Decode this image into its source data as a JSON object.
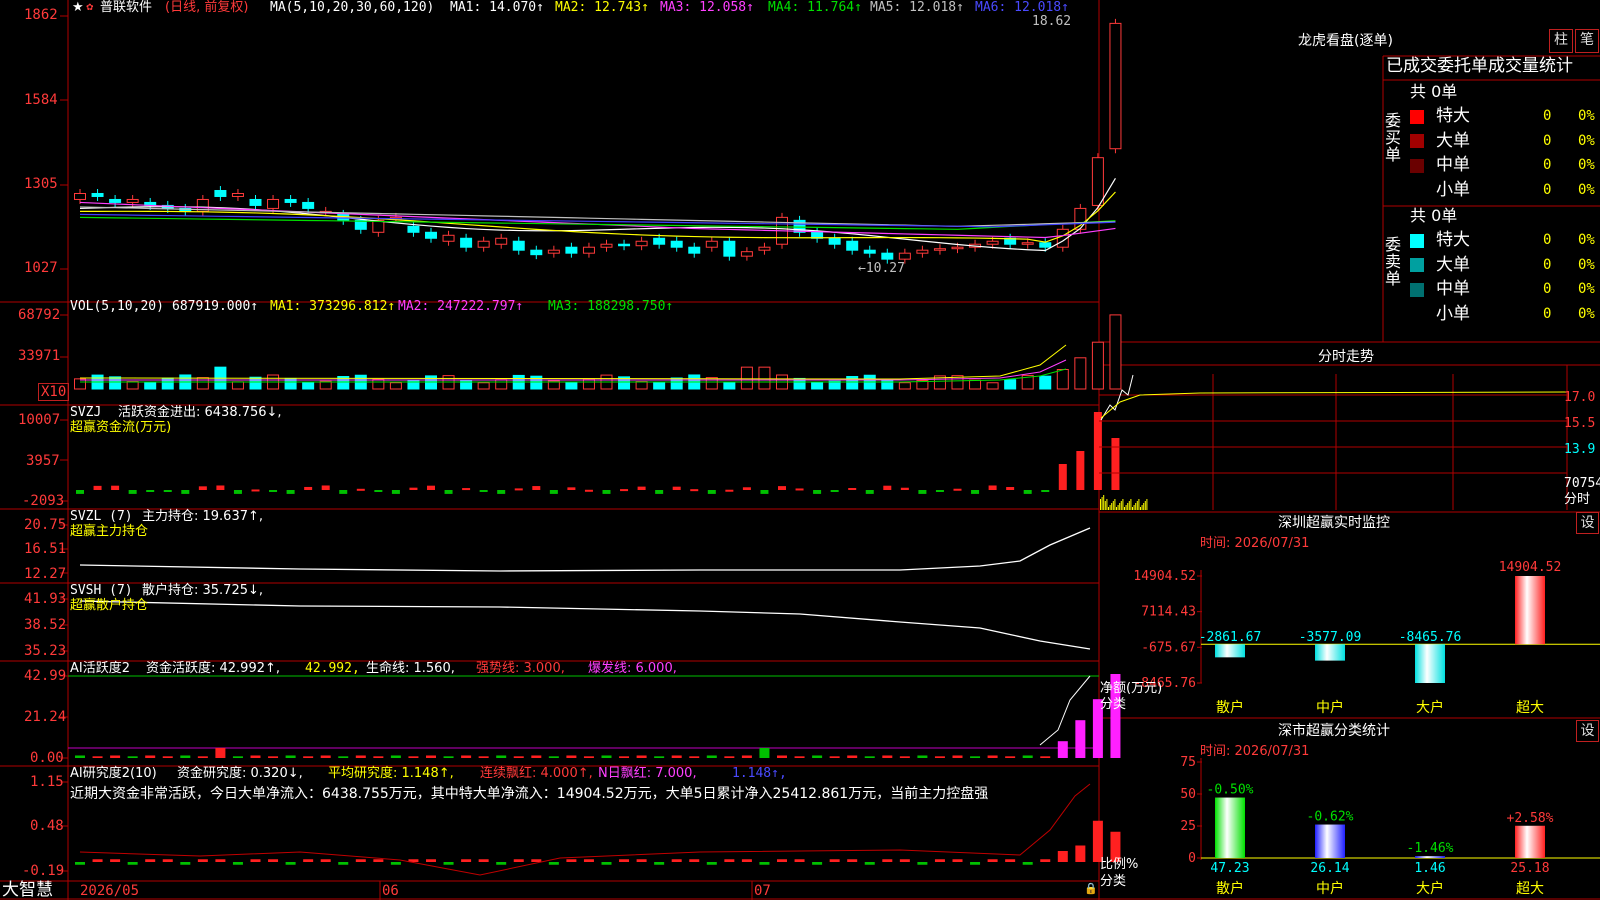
{
  "stock": {
    "name": "普联软件",
    "period": "(日线, 前复权)"
  },
  "ma_legend": {
    "params": "MA(5,10,20,30,60,120)",
    "items": [
      {
        "text": "MA1: 14.070↑",
        "color": "#ffffff"
      },
      {
        "text": "MA2: 12.743↑",
        "color": "#ffff00"
      },
      {
        "text": "MA3: 12.058↑",
        "color": "#ff40ff"
      },
      {
        "text": "MA4: 11.764↑",
        "color": "#00e000"
      },
      {
        "text": "MA5: 12.018↑",
        "color": "#c0c0c0"
      },
      {
        "text": "MA6: 12.018↑",
        "color": "#4040ff"
      }
    ]
  },
  "price_axis": [
    "1862",
    "1584",
    "1305",
    "1027"
  ],
  "price_max_label": "18.62",
  "price_min_label": "←10.27",
  "vol_legend": {
    "params": "VOL(5,10,20)",
    "value": "687919.000↑",
    "ma1": "MA1: 373296.812↑",
    "ma2": "MA2: 247222.797↑",
    "ma3": "MA3: 188298.750↑"
  },
  "vol_axis": [
    "68792",
    "33971"
  ],
  "vol_unit": "X10",
  "svzj": {
    "name": "SVZJ",
    "label": "活跃资金进出: 6438.756↓,",
    "sub": "超赢资金流(万元)",
    "axis": [
      "10007",
      "3957",
      "-2093"
    ]
  },
  "svzl": {
    "name": "SVZL (7)",
    "label": "主力持仓: 19.637↑,",
    "sub": "超赢主力持仓",
    "axis": [
      "20.75",
      "16.51",
      "12.27"
    ]
  },
  "svsh": {
    "name": "SVSH (7)",
    "label": "散户持仓: 35.725↓,",
    "sub": "超赢散户持仓",
    "axis": [
      "41.93",
      "38.52",
      "35.23"
    ]
  },
  "ai_active": {
    "name": "AI活跃度2",
    "label": "资金活跃度: 42.992↑,",
    "v2": "42.992,",
    "life": "生命线: 1.560,",
    "strong": "强势线: 3.000,",
    "burst": "爆发线: 6.000,",
    "axis": [
      "42.99",
      "21.24",
      "0.00"
    ]
  },
  "ai_research": {
    "name": "AI研究度2(10)",
    "label": "资金研究度: 0.320↓,",
    "avg": "平均研究度: 1.148↑,",
    "cont": "连续飘红: 4.000↑,",
    "nday": "N日飘红: 7.000,",
    "v": "1.148↑,",
    "comment": "近期大资金非常活跃，今日大单净流入：6438.755万元，其中特大单净流入：14904.52万元，大单5日累计净入25412.861万元，当前主力控盘强",
    "axis": [
      "1.15",
      "0.48",
      "-0.19"
    ]
  },
  "date_axis": [
    "2026/05",
    "06",
    "07"
  ],
  "brand": "大智慧",
  "dragon": {
    "title": "龙虎看盘(逐单)",
    "btn1": "柱",
    "btn2": "笔",
    "subtitle": "已成交委托单成交量统计",
    "buy": {
      "side": "委买单",
      "total": "共 0单",
      "rows": [
        {
          "label": "特大",
          "count": "0",
          "pct": "0%",
          "color": "#ff0000"
        },
        {
          "label": "大单",
          "count": "0",
          "pct": "0%",
          "color": "#a00000"
        },
        {
          "label": "中单",
          "count": "0",
          "pct": "0%",
          "color": "#6a0000"
        },
        {
          "label": "小单",
          "count": "0",
          "pct": "0%",
          "color": "#000000"
        }
      ]
    },
    "sell": {
      "side": "委卖单",
      "total": "共 0单",
      "rows": [
        {
          "label": "特大",
          "count": "0",
          "pct": "0%",
          "color": "#00ffff"
        },
        {
          "label": "大单",
          "count": "0",
          "pct": "0%",
          "color": "#00a0a0"
        },
        {
          "label": "中单",
          "count": "0",
          "pct": "0%",
          "color": "#007070"
        },
        {
          "label": "小单",
          "count": "0",
          "pct": "0%",
          "color": "#000000"
        }
      ]
    }
  },
  "intraday": {
    "title": "分时走势",
    "axis": [
      "17.0",
      "15.5",
      "13.9",
      "70754"
    ],
    "unit": "分时"
  },
  "monitor": {
    "title": "深圳超赢实时监控",
    "btn": "设",
    "time": "时间: 2026/07/31",
    "axis": [
      "14904.52",
      "7114.43",
      "-675.67",
      "-8465.76"
    ],
    "ylabel": "净额(万元)",
    "xlabel": "分类",
    "bars": [
      {
        "cat": "散户",
        "value": -2861.67,
        "label": "-2861.67"
      },
      {
        "cat": "中户",
        "value": -3577.09,
        "label": "-3577.09"
      },
      {
        "cat": "大户",
        "value": -8465.76,
        "label": "-8465.76"
      },
      {
        "cat": "超大",
        "value": 14904.52,
        "label": "14904.52"
      }
    ]
  },
  "classify": {
    "title": "深市超赢分类统计",
    "btn": "设",
    "time": "时间: 2026/07/31",
    "axis": [
      "75",
      "50",
      "25",
      "0"
    ],
    "ylabel": "比例%",
    "xlabel": "分类",
    "bars": [
      {
        "cat": "散户",
        "value": 47.23,
        "label": "47.23",
        "chg": "-0.50%"
      },
      {
        "cat": "中户",
        "value": 26.14,
        "label": "26.14",
        "chg": "-0.62%"
      },
      {
        "cat": "大户",
        "value": 1.46,
        "label": "1.46",
        "chg": "-1.46%"
      },
      {
        "cat": "超大",
        "value": 25.18,
        "label": "25.18",
        "chg": "+2.58%"
      }
    ]
  },
  "chart_data": [
    {
      "type": "bar",
      "title": "深圳超赢实时监控",
      "categories": [
        "散户",
        "中户",
        "大户",
        "超大"
      ],
      "values": [
        -2861.67,
        -3577.09,
        -8465.76,
        14904.52
      ],
      "ylabel": "净额(万元)",
      "xlabel": "分类",
      "ylim": [
        -8465.76,
        14904.52
      ]
    },
    {
      "type": "bar",
      "title": "深市超赢分类统计",
      "categories": [
        "散户",
        "中户",
        "大户",
        "超大"
      ],
      "values": [
        47.23,
        26.14,
        1.46,
        25.18
      ],
      "ylabel": "比例%",
      "xlabel": "分类",
      "ylim": [
        0,
        75
      ]
    }
  ],
  "colors": {
    "up": "#ff3a3a",
    "down": "#00ffff",
    "grid": "#b00000",
    "bg": "#000000"
  }
}
